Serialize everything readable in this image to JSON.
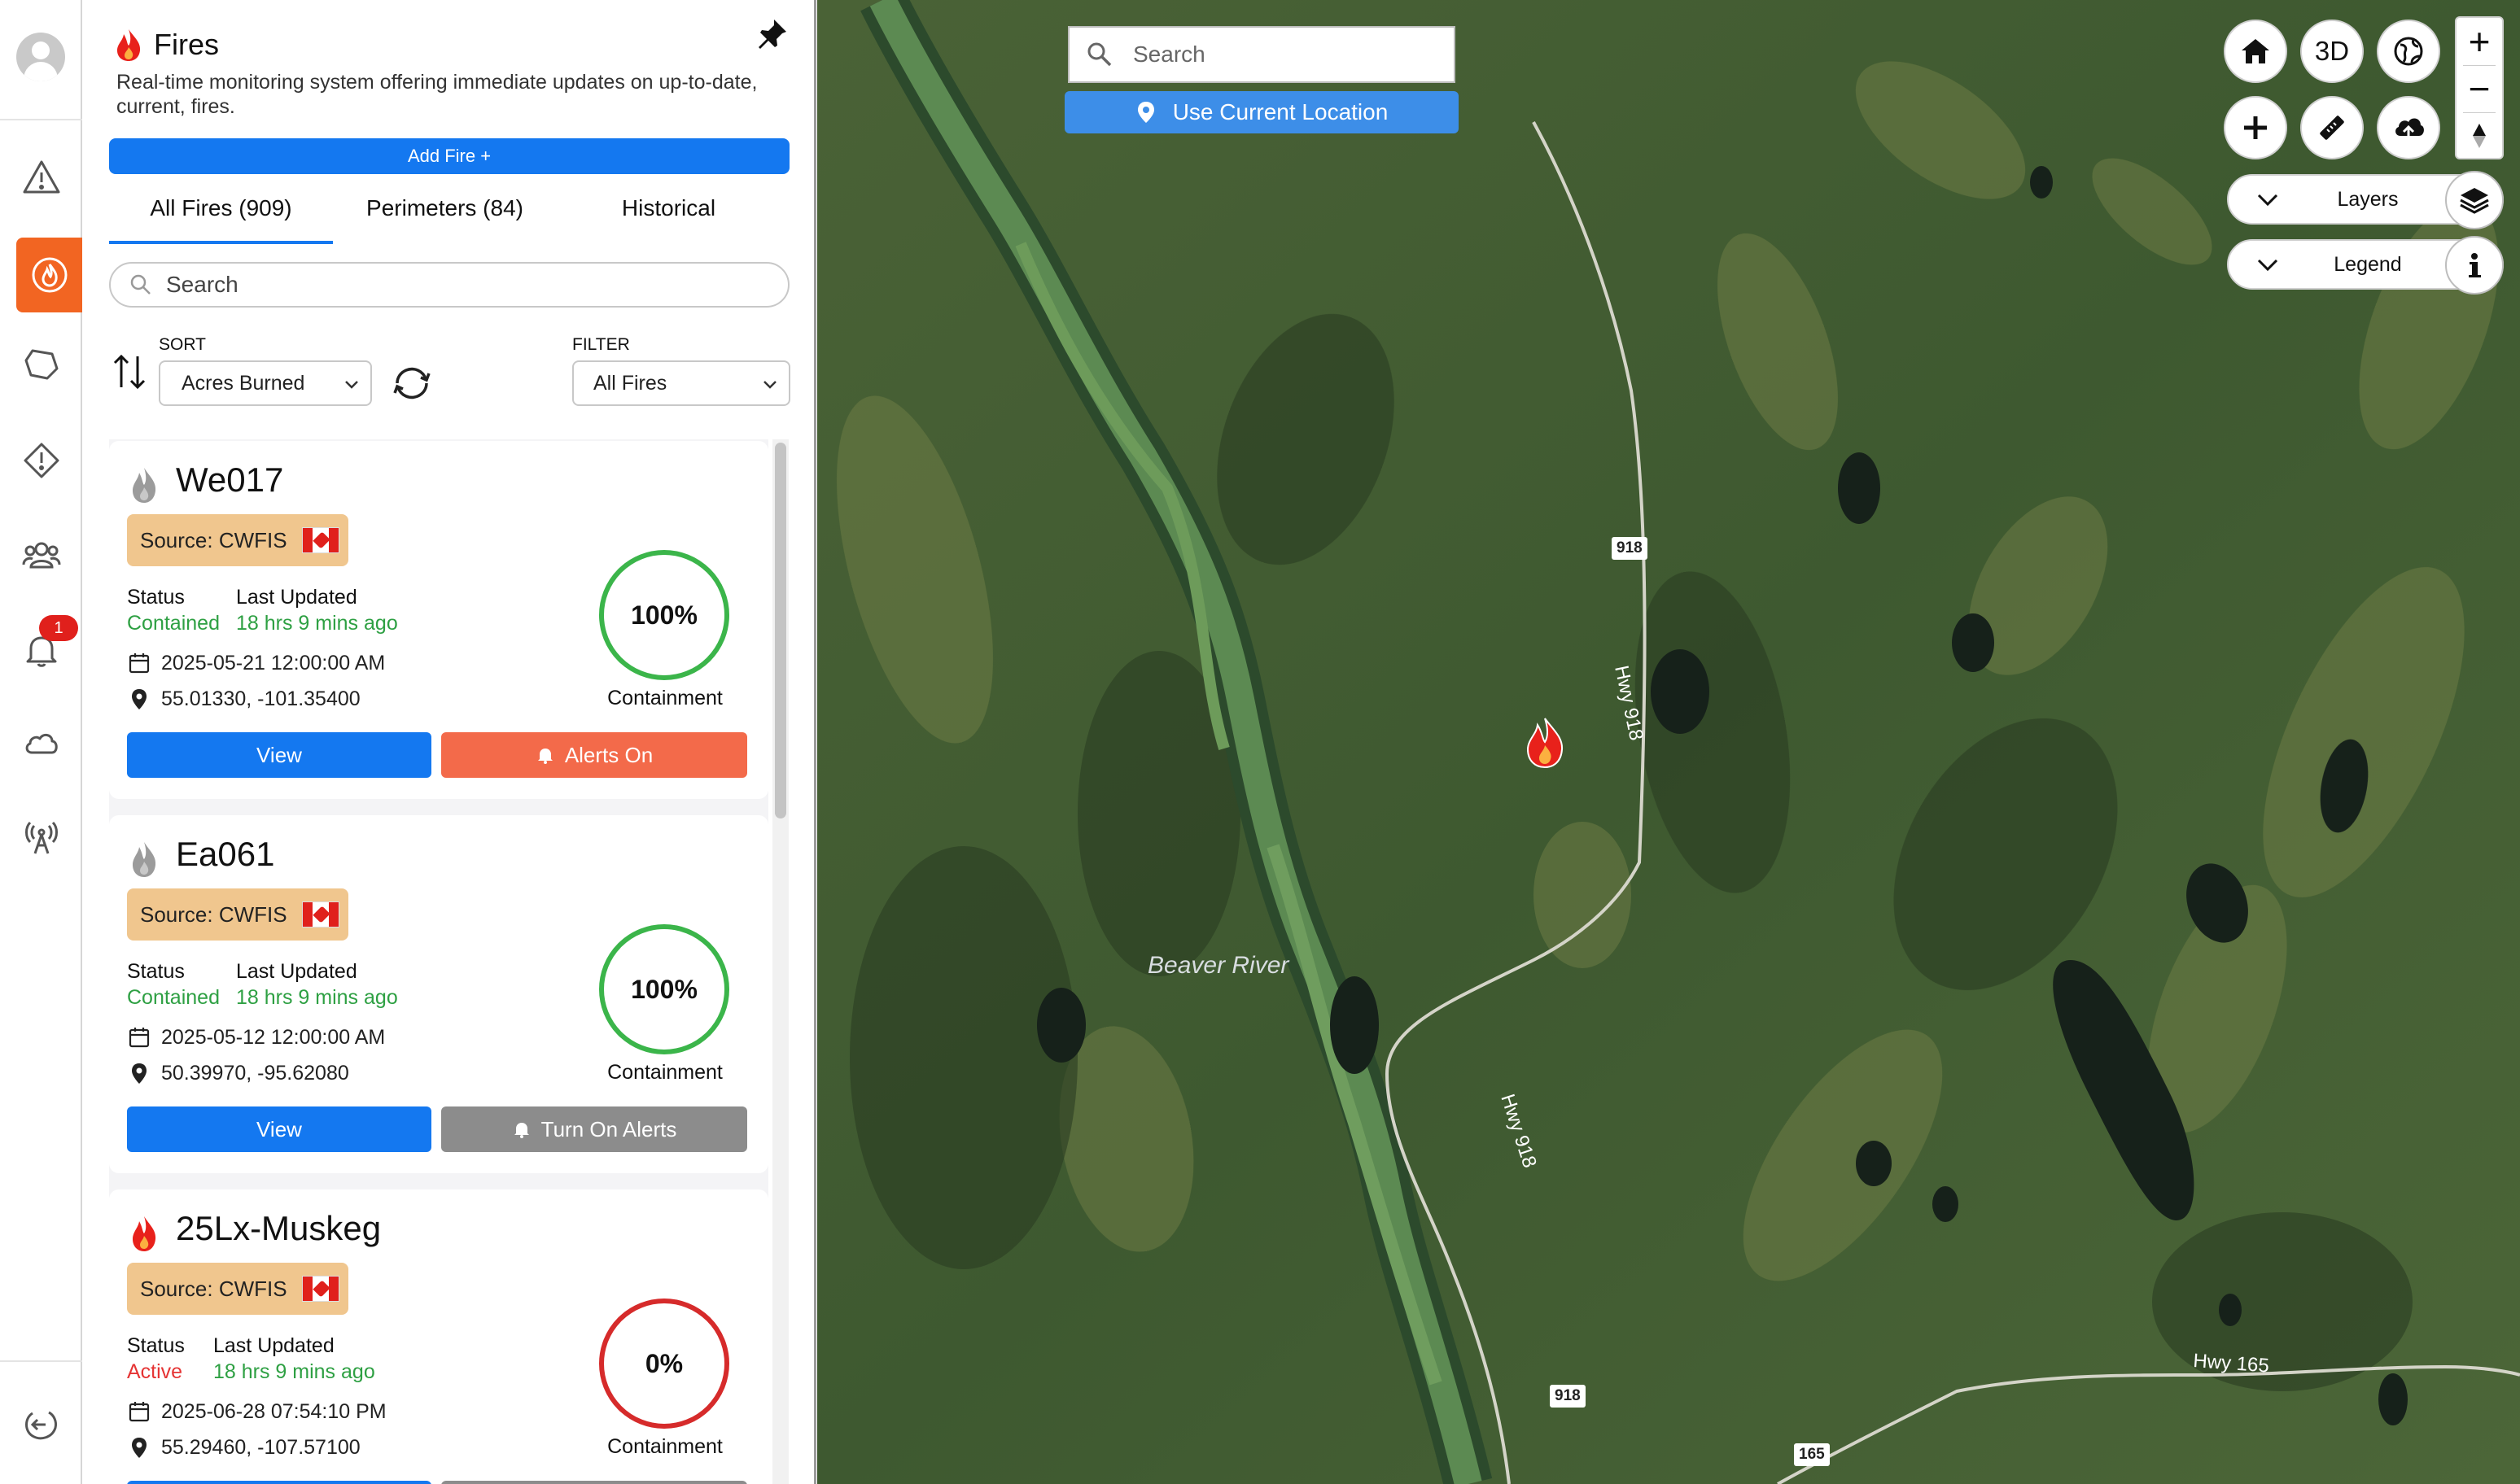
{
  "rail": {
    "items": [
      "avatar",
      "warning",
      "fires",
      "perimeters",
      "alerts",
      "community",
      "notifications",
      "weather",
      "stations",
      "logout"
    ],
    "notification_count": "1",
    "active_color": "#f26522"
  },
  "panel": {
    "title": "Fires",
    "description": "Real-time monitoring system offering immediate updates on up-to-date, current, fires.",
    "add_fire_label": "Add Fire +",
    "tabs": [
      {
        "label": "All Fires (909)"
      },
      {
        "label": "Perimeters (84)"
      },
      {
        "label": "Historical"
      }
    ],
    "search_placeholder": "Search",
    "sort": {
      "label": "SORT",
      "value": "Acres Burned"
    },
    "filter": {
      "label": "FILTER",
      "value": "All Fires"
    }
  },
  "fires": [
    {
      "name": "We017",
      "source": "Source: CWFIS",
      "status_label": "Status",
      "status": "Contained",
      "updated_label": "Last Updated",
      "updated": "18 hrs 9 mins ago",
      "date": "2025-05-21 12:00:00 AM",
      "coords": "55.01330, -101.35400",
      "containment": "100%",
      "containment_label": "Containment",
      "view_label": "View",
      "alert_label": "Alerts On"
    },
    {
      "name": "Ea061",
      "source": "Source: CWFIS",
      "status_label": "Status",
      "status": "Contained",
      "updated_label": "Last Updated",
      "updated": "18 hrs 9 mins ago",
      "date": "2025-05-12 12:00:00 AM",
      "coords": "50.39970, -95.62080",
      "containment": "100%",
      "containment_label": "Containment",
      "view_label": "View",
      "alert_label": "Turn On Alerts"
    },
    {
      "name": "25Lx-Muskeg",
      "source": "Source: CWFIS",
      "status_label": "Status",
      "status": "Active",
      "updated_label": "Last Updated",
      "updated": "18 hrs 9 mins ago",
      "date": "2025-06-28 07:54:10 PM",
      "coords": "55.29460, -107.57100",
      "containment": "0%",
      "containment_label": "Containment"
    }
  ],
  "map": {
    "search_placeholder": "Search",
    "use_location_label": "Use Current Location",
    "toolbar_3d": "3D",
    "zoom_in": "+",
    "zoom_out": "−",
    "layers_label": "Layers",
    "legend_label": "Legend",
    "river_label": "Beaver River",
    "road_labels": [
      "Hwy 918",
      "Hwy 918",
      "Hwy 165"
    ],
    "shields": [
      "918",
      "918",
      "918",
      "165"
    ],
    "colors": {
      "fire": "#e8211b",
      "status_contained": "#2ea043",
      "status_active": "#e53434",
      "primary": "#1478f0"
    }
  }
}
